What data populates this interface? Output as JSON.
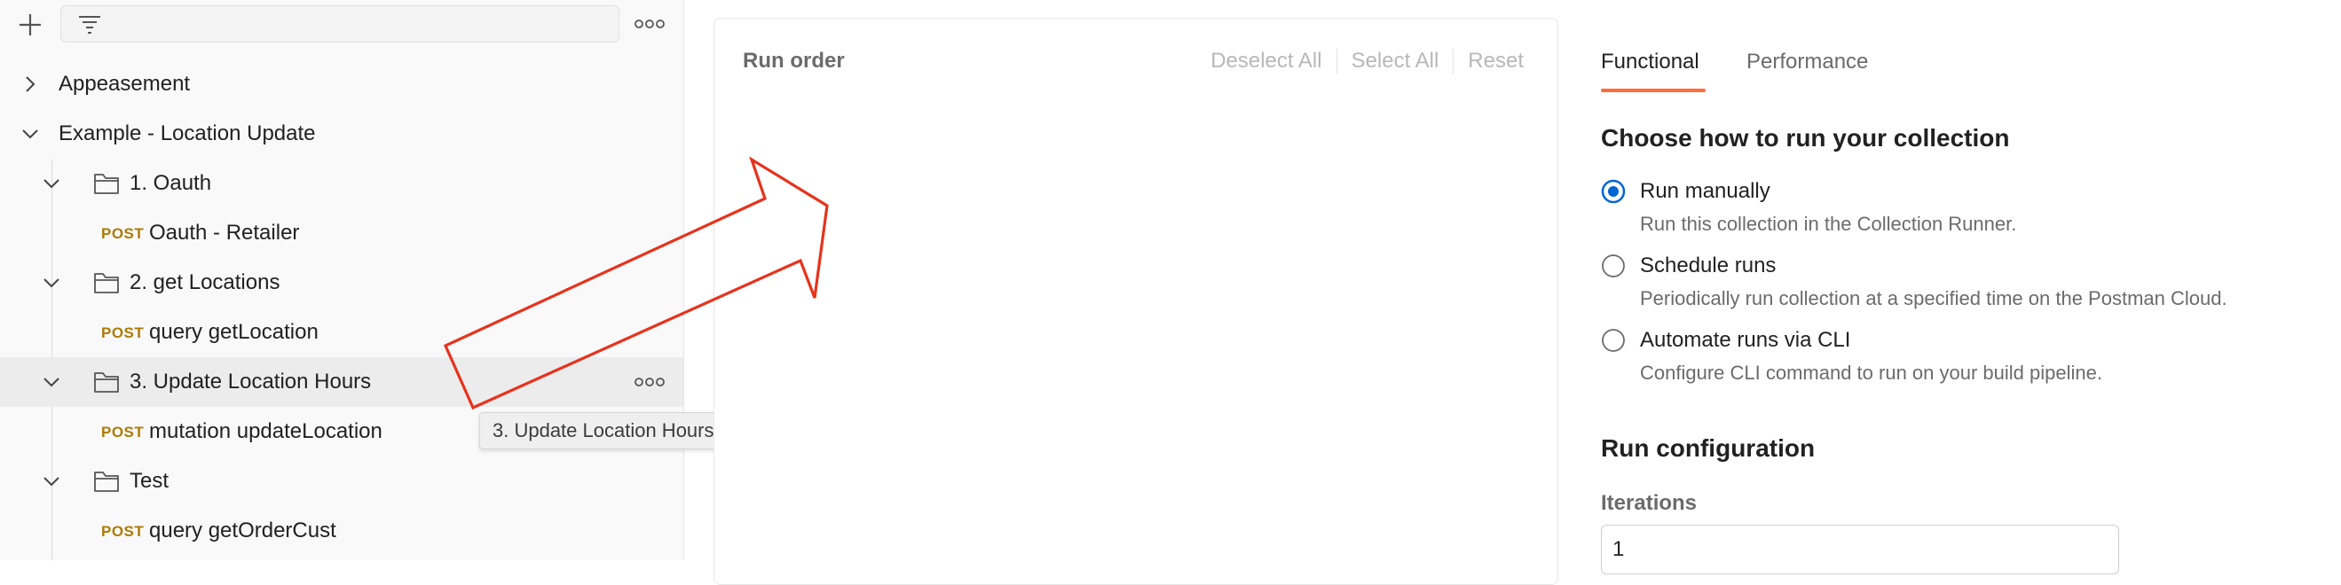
{
  "sidebar": {
    "filter_placeholder": "",
    "items": [
      {
        "label": "Appeasement",
        "type": "collection",
        "expanded": false
      },
      {
        "label": "Example - Location Update",
        "type": "collection",
        "expanded": true
      },
      {
        "label": "1. Oauth",
        "type": "folder",
        "expanded": true
      },
      {
        "method": "POST",
        "label": "Oauth - Retailer",
        "type": "request"
      },
      {
        "label": "2. get Locations",
        "type": "folder",
        "expanded": true
      },
      {
        "method": "POST",
        "label": "query getLocation",
        "type": "request"
      },
      {
        "label": "3. Update Location Hours",
        "type": "folder",
        "expanded": true,
        "hovered": true
      },
      {
        "method": "POST",
        "label": "mutation updateLocation",
        "type": "request"
      },
      {
        "label": "Test",
        "type": "folder",
        "expanded": true
      },
      {
        "method": "POST",
        "label": "query getOrderCust",
        "type": "request"
      }
    ],
    "tooltip": "3. Update Location Hours"
  },
  "run_order": {
    "title": "Run order",
    "deselect_all": "Deselect All",
    "select_all": "Select All",
    "reset": "Reset"
  },
  "tabs": [
    {
      "label": "Functional",
      "active": true
    },
    {
      "label": "Performance",
      "active": false
    }
  ],
  "run_mode": {
    "heading": "Choose how to run your collection",
    "options": [
      {
        "label": "Run manually",
        "description": "Run this collection in the Collection Runner.",
        "selected": true
      },
      {
        "label": "Schedule runs",
        "description": "Periodically run collection at a specified time on the Postman Cloud.",
        "selected": false
      },
      {
        "label": "Automate runs via CLI",
        "description": "Configure CLI command to run on your build pipeline.",
        "selected": false
      }
    ]
  },
  "run_config": {
    "heading": "Run configuration",
    "iterations_label": "Iterations",
    "iterations_value": "1"
  },
  "colors": {
    "accent_tab": "#ff6c37",
    "radio_selected": "#0265d2",
    "post_method": "#ad7a03",
    "arrow": "#e8321c"
  },
  "icons": [
    "plus-icon",
    "filter-icon",
    "more-icon",
    "chevron-right-icon",
    "chevron-down-icon",
    "folder-icon",
    "radio-selected-icon",
    "radio-empty-icon",
    "arrow-annotation"
  ]
}
